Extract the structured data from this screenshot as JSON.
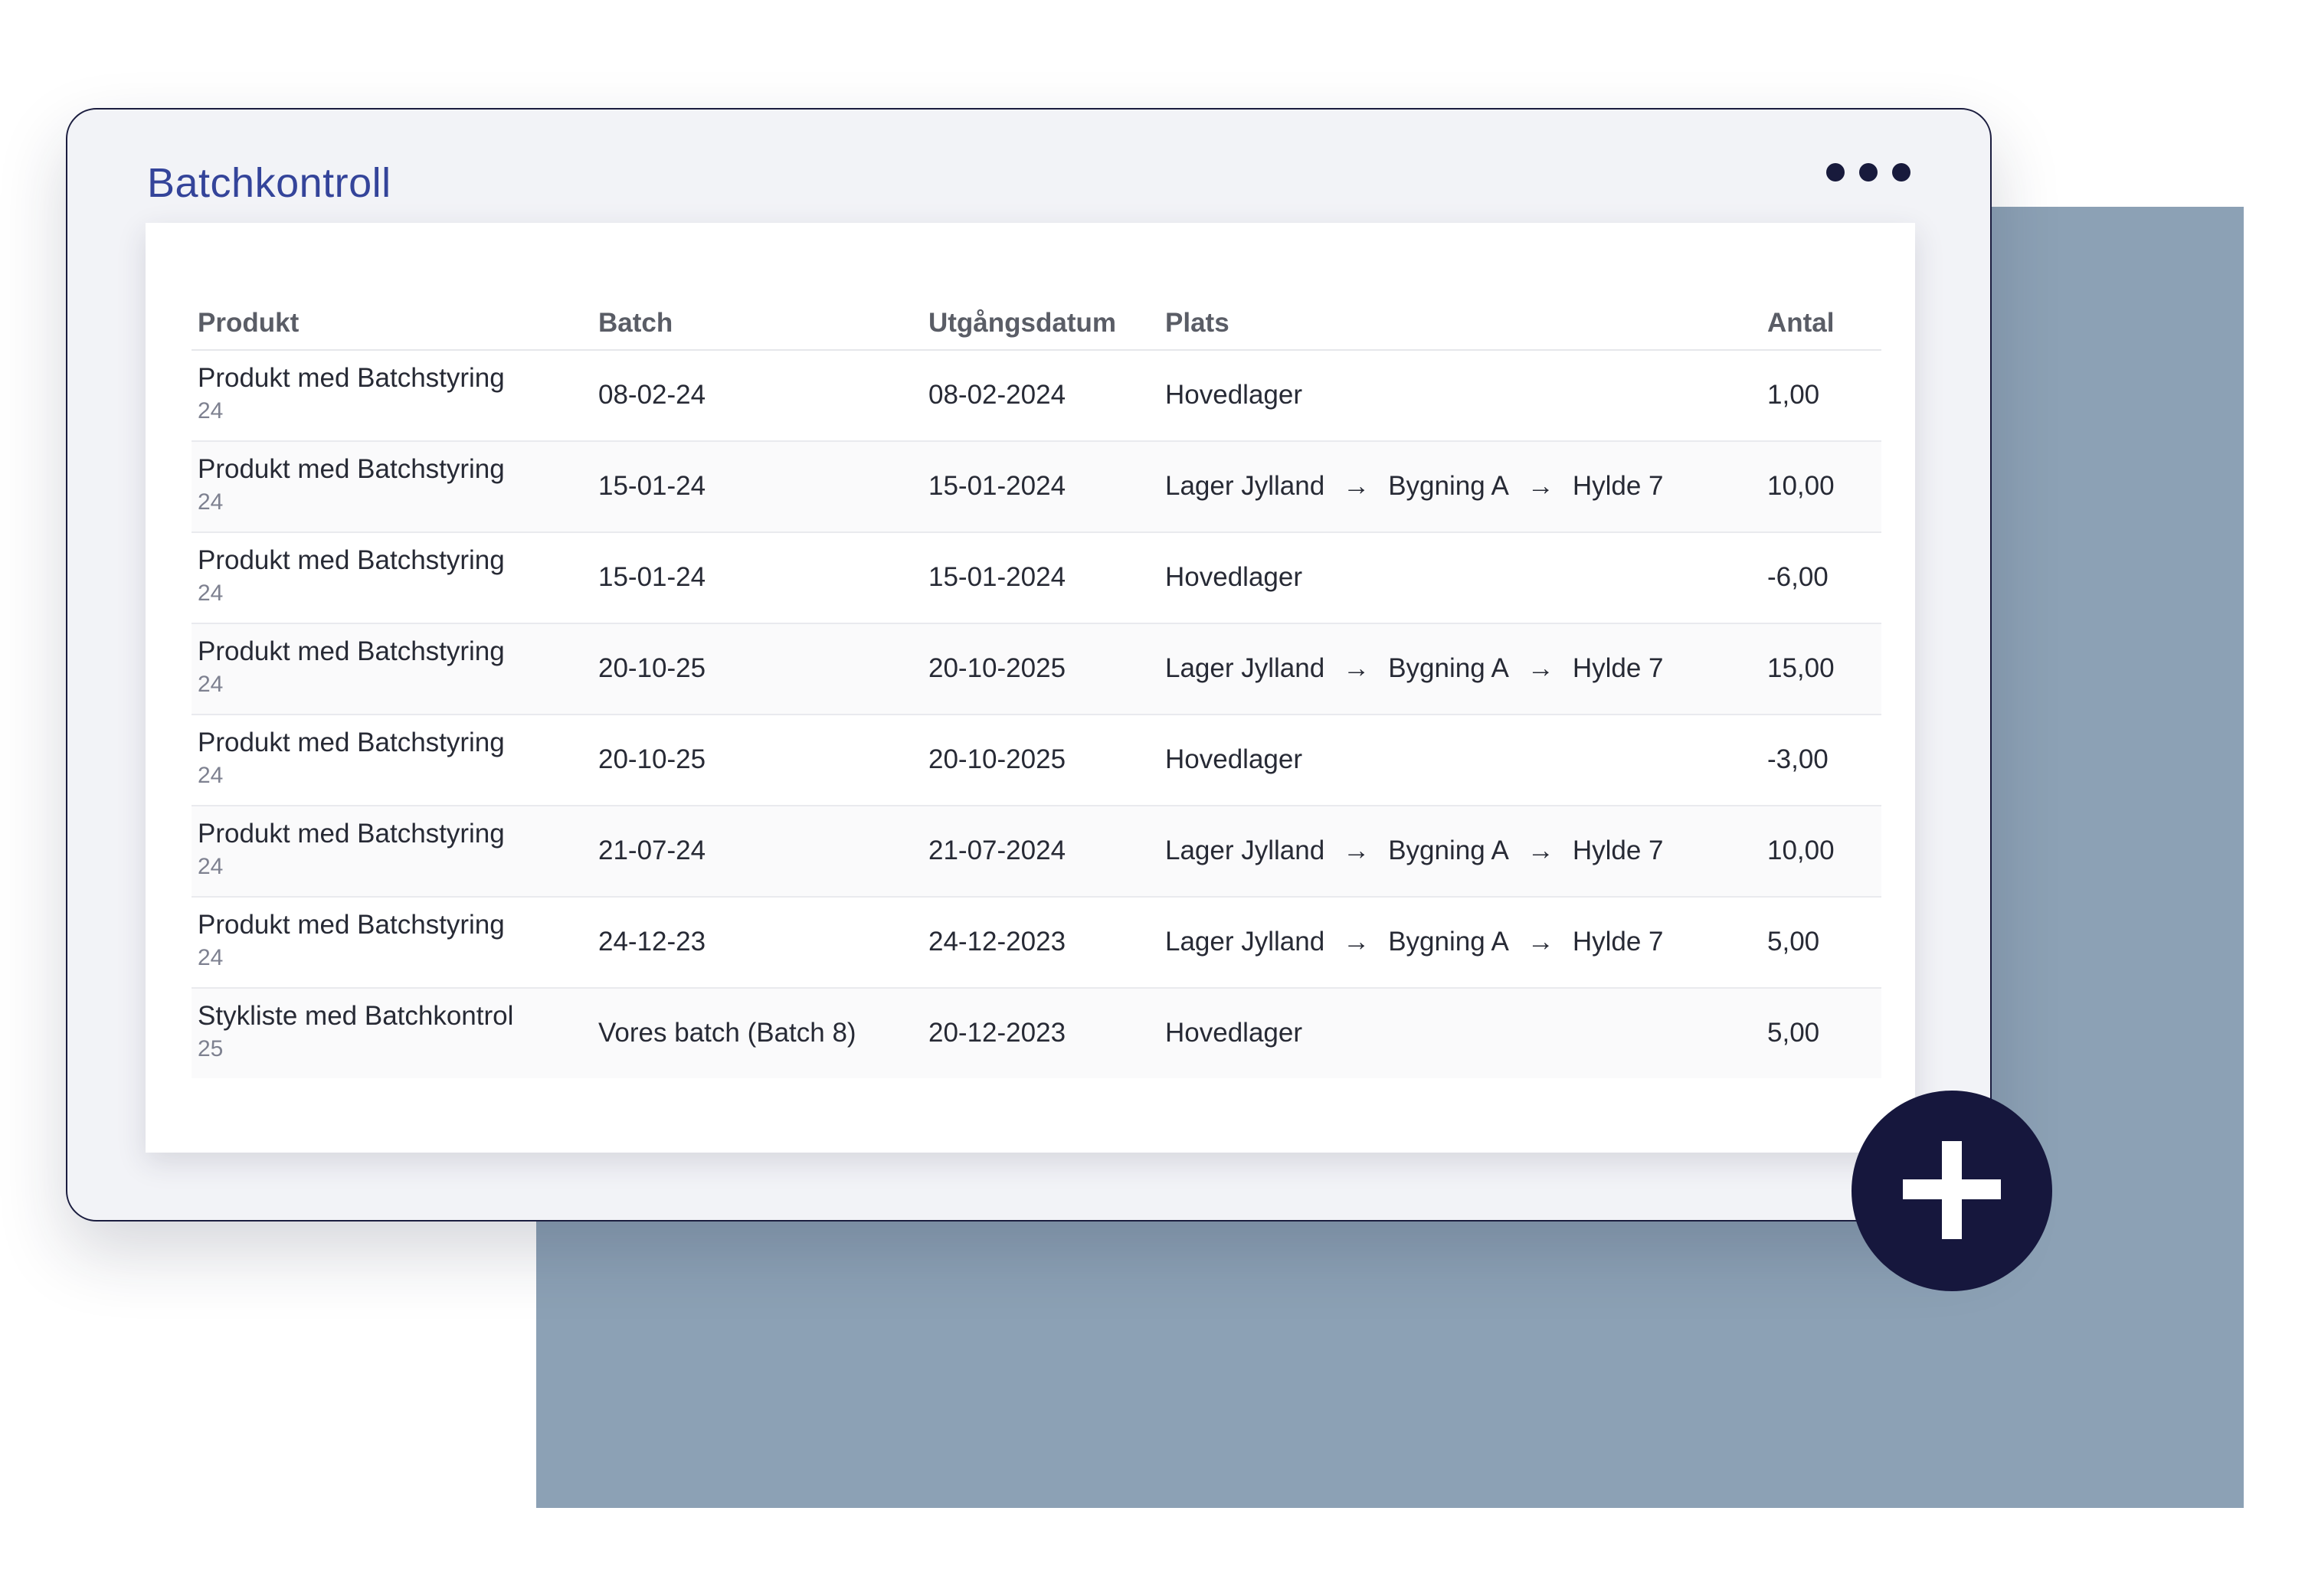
{
  "window": {
    "title": "Batchkontroll"
  },
  "columns": {
    "produkt": "Produkt",
    "batch": "Batch",
    "date": "Utgångsdatum",
    "plats": "Plats",
    "antal": "Antal"
  },
  "rows": [
    {
      "product": "Produkt med Batchstyring",
      "product_no": "24",
      "batch": "08-02-24",
      "date": "08-02-2024",
      "plats": [
        "Hovedlager"
      ],
      "antal": "1,00"
    },
    {
      "product": "Produkt med Batchstyring",
      "product_no": "24",
      "batch": "15-01-24",
      "date": "15-01-2024",
      "plats": [
        "Lager Jylland",
        "Bygning A",
        "Hylde 7"
      ],
      "antal": "10,00"
    },
    {
      "product": "Produkt med Batchstyring",
      "product_no": "24",
      "batch": "15-01-24",
      "date": "15-01-2024",
      "plats": [
        "Hovedlager"
      ],
      "antal": "-6,00"
    },
    {
      "product": "Produkt med Batchstyring",
      "product_no": "24",
      "batch": "20-10-25",
      "date": "20-10-2025",
      "plats": [
        "Lager Jylland",
        "Bygning A",
        "Hylde 7"
      ],
      "antal": "15,00"
    },
    {
      "product": "Produkt med Batchstyring",
      "product_no": "24",
      "batch": "20-10-25",
      "date": "20-10-2025",
      "plats": [
        "Hovedlager"
      ],
      "antal": "-3,00"
    },
    {
      "product": "Produkt med Batchstyring",
      "product_no": "24",
      "batch": "21-07-24",
      "date": "21-07-2024",
      "plats": [
        "Lager Jylland",
        "Bygning A",
        "Hylde 7"
      ],
      "antal": "10,00"
    },
    {
      "product": "Produkt med Batchstyring",
      "product_no": "24",
      "batch": "24-12-23",
      "date": "24-12-2023",
      "plats": [
        "Lager Jylland",
        "Bygning A",
        "Hylde 7"
      ],
      "antal": "5,00"
    },
    {
      "product": "Stykliste med Batchkontrol",
      "product_no": "25",
      "batch": "Vores batch (Batch 8)",
      "date": "20-12-2023",
      "plats": [
        "Hovedlager"
      ],
      "antal": "5,00"
    }
  ],
  "icons": {
    "more": "more-horizontal-icon",
    "add": "plus-icon",
    "path_separator": "arrow-right-icon"
  },
  "colors": {
    "title": "#34449a",
    "dark": "#16173d",
    "backdrop": "#8ca1b5"
  }
}
